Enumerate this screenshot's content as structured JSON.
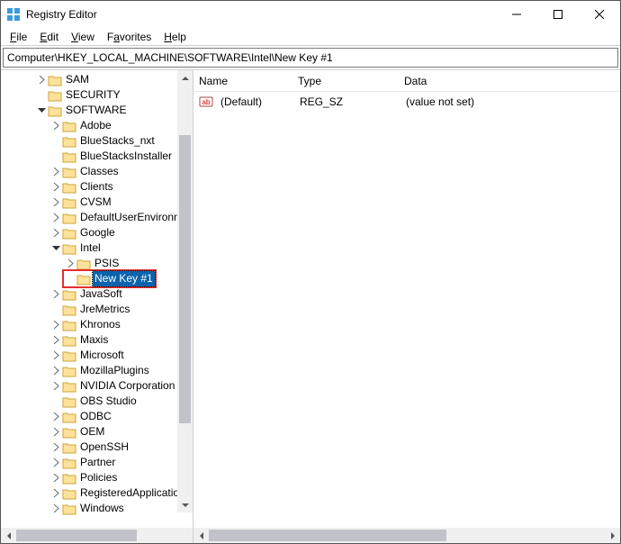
{
  "window": {
    "title": "Registry Editor"
  },
  "menu": {
    "file": "File",
    "edit": "Edit",
    "view": "View",
    "favorites": "Favorites",
    "help": "Help"
  },
  "address": {
    "path": "Computer\\HKEY_LOCAL_MACHINE\\SOFTWARE\\Intel\\New Key #1"
  },
  "tree": {
    "sam": "SAM",
    "security": "SECURITY",
    "software": "SOFTWARE",
    "adobe": "Adobe",
    "bluestacks_nxt": "BlueStacks_nxt",
    "bluestacksinstaller": "BlueStacksInstaller",
    "classes": "Classes",
    "clients": "Clients",
    "cvsm": "CVSM",
    "defaultuserenv": "DefaultUserEnvironm",
    "google": "Google",
    "intel": "Intel",
    "psis": "PSIS",
    "newkey1": "New Key #1",
    "javasoft": "JavaSoft",
    "jremetrics": "JreMetrics",
    "khronos": "Khronos",
    "maxis": "Maxis",
    "microsoft": "Microsoft",
    "mozillaplugins": "MozillaPlugins",
    "nvidia": "NVIDIA Corporation",
    "obs": "OBS Studio",
    "odbc": "ODBC",
    "oem": "OEM",
    "openssh": "OpenSSH",
    "partner": "Partner",
    "policies": "Policies",
    "registeredapp": "RegisteredApplicatio",
    "windows": "Windows"
  },
  "list": {
    "header_name": "Name",
    "header_type": "Type",
    "header_data": "Data",
    "row_default_name": "(Default)",
    "row_default_type": "REG_SZ",
    "row_default_data": "(value not set)"
  }
}
